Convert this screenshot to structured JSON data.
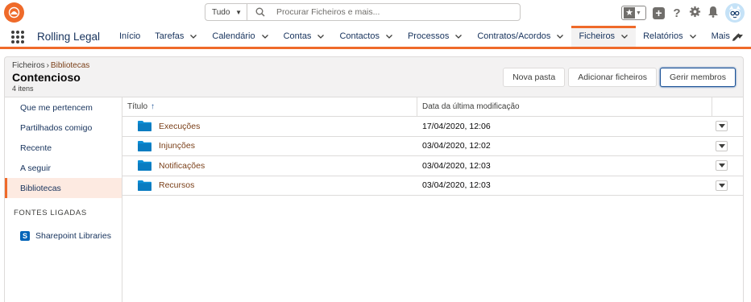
{
  "global_header": {
    "search_scope": "Tudo",
    "search_placeholder": "Procurar Ficheiros e mais..."
  },
  "app": {
    "name": "Rolling Legal"
  },
  "nav": {
    "items": [
      {
        "label": "Início",
        "dropdown": false
      },
      {
        "label": "Tarefas",
        "dropdown": true
      },
      {
        "label": "Calendário",
        "dropdown": true
      },
      {
        "label": "Contas",
        "dropdown": true
      },
      {
        "label": "Contactos",
        "dropdown": true
      },
      {
        "label": "Processos",
        "dropdown": true
      },
      {
        "label": "Contratos/Acordos",
        "dropdown": true
      },
      {
        "label": "Ficheiros",
        "dropdown": true,
        "active": true
      },
      {
        "label": "Relatórios",
        "dropdown": true
      },
      {
        "label": "Mais",
        "dropdown": true
      }
    ]
  },
  "page_header": {
    "breadcrumb_root": "Ficheiros",
    "breadcrumb_current": "Bibliotecas",
    "title": "Contencioso",
    "count": "4 itens",
    "buttons": [
      "Nova pasta",
      "Adicionar ficheiros",
      "Gerir membros"
    ]
  },
  "sidebar": {
    "items": [
      "Que me pertencem",
      "Partilhados comigo",
      "Recente",
      "A seguir",
      "Bibliotecas"
    ],
    "active_index": 4,
    "section_title": "FONTES LIGADAS",
    "connected_item": "Sharepoint Libraries"
  },
  "table": {
    "columns": {
      "title": "Título",
      "modified": "Data da última modificação"
    },
    "sort_indicator": "↑",
    "rows": [
      {
        "name": "Execuções",
        "modified": "17/04/2020, 12:06"
      },
      {
        "name": "Injunções",
        "modified": "03/04/2020, 12:02"
      },
      {
        "name": "Notificações",
        "modified": "03/04/2020, 12:03"
      },
      {
        "name": "Recursos",
        "modified": "03/04/2020, 12:03"
      }
    ]
  },
  "colors": {
    "accent": "#ef6a2a",
    "link": "#7a3f18",
    "folder": "#0c8fd6",
    "active_tab_bg": "#f3f2f2"
  }
}
